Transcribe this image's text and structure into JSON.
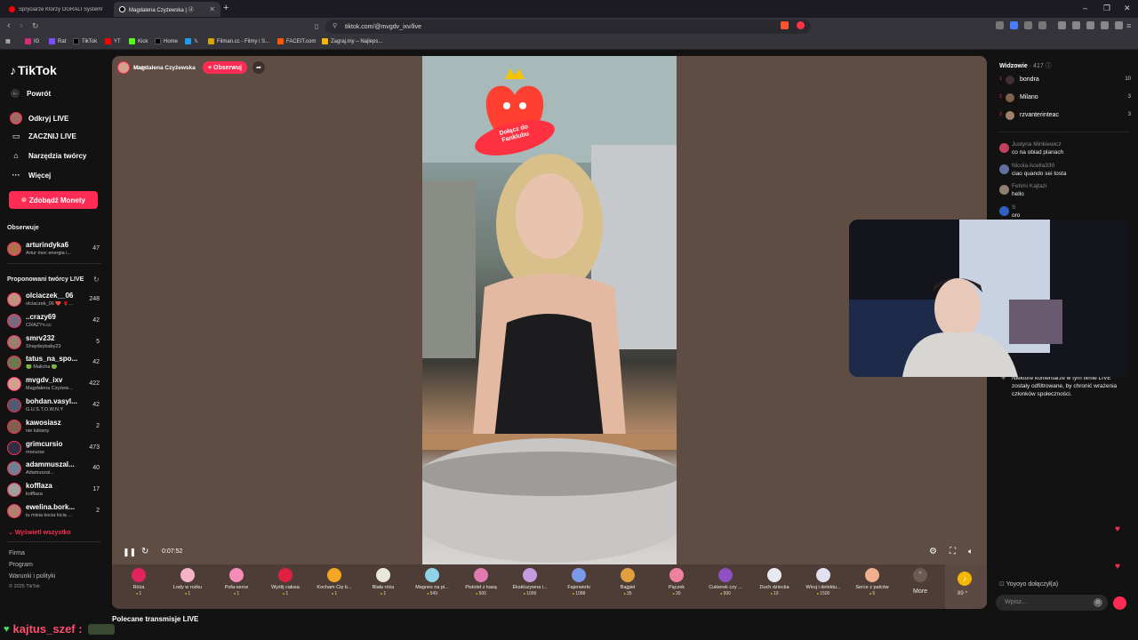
{
  "browser": {
    "tabs": [
      {
        "title": "Spryciarze Którzy OGRALI System! TT",
        "favicon_color": "#ff0000"
      },
      {
        "title": "Magdalena Czyżewska | ⓓ",
        "favicon_color": "#000000"
      }
    ],
    "new_tab": "+",
    "window_controls": [
      "–",
      "❐",
      "✕"
    ],
    "url": "tiktok.com/@mvgdv_ixv/live",
    "bookmarks": [
      {
        "label": "IG",
        "color": "#d62976"
      },
      {
        "label": "Rat",
        "color": "#7b4dff"
      },
      {
        "label": "TikTok",
        "color": "#000000"
      },
      {
        "label": "YT",
        "color": "#ff0000"
      },
      {
        "label": "Kick",
        "color": "#53fc18"
      },
      {
        "label": "Home",
        "color": "#000000"
      },
      {
        "label": "𝕏",
        "color": "#1d9bf0"
      },
      {
        "label": "Filman.cc - Filmy i S...",
        "color": "#d9a400"
      },
      {
        "label": "FACEIT.com",
        "color": "#ff5500"
      },
      {
        "label": "Zagraj.my – Najleps...",
        "color": "#f2b600"
      }
    ]
  },
  "sidebar": {
    "logo": "TikTok",
    "nav": [
      {
        "icon": "←",
        "label": "Powrót"
      },
      {
        "icon": "●",
        "label": "Odkryj LIVE"
      },
      {
        "icon": "▭",
        "label": "ZACZNIJ LIVE"
      },
      {
        "icon": "⌂",
        "label": "Narzędzia twórcy"
      },
      {
        "icon": "···",
        "label": "Więcej"
      }
    ],
    "coins_button": "Zdobądź Monety",
    "following_header": "Obserwuje",
    "following": [
      {
        "name": "arturindyka6",
        "sub": "Artur moc energia i...",
        "count": "47",
        "color": "#b07050"
      }
    ],
    "suggested_header": "Proponowani twórcy LIVE",
    "suggested": [
      {
        "name": "olciaczek__06",
        "sub": "olciaczek_06 ❤️ 🌹...",
        "count": "248",
        "color": "#c09080"
      },
      {
        "name": "..crazy69",
        "sub": "CRAZYn.cc",
        "count": "42",
        "color": "#7a6a80"
      },
      {
        "name": "smrv232",
        "sub": "Shaydeybaby23",
        "count": "5",
        "color": "#9a8070"
      },
      {
        "name": "tatus_na_spo...",
        "sub": "🟢 Malicha 🟢",
        "count": "42",
        "color": "#6a7a50"
      },
      {
        "name": "mvgdv_ixv",
        "sub": "Magdalena Czyżew...",
        "count": "422",
        "color": "#d6a090"
      },
      {
        "name": "bohdan.vasyl...",
        "sub": "G.U.S.T.O.W.N.Y",
        "count": "42",
        "color": "#505a70"
      },
      {
        "name": "kawosiasz",
        "sub": "nie lubiany",
        "count": "2",
        "color": "#806050"
      },
      {
        "name": "grimcursio",
        "sub": "mocurse",
        "count": "473",
        "color": "#303040"
      },
      {
        "name": "adammuszal...",
        "sub": "Adamuszal...",
        "count": "40",
        "color": "#708090"
      },
      {
        "name": "kofflaza",
        "sub": "kofflaza",
        "count": "17",
        "color": "#a0a0a0"
      },
      {
        "name": "ewelina.bork...",
        "sub": "tu misia kocia kicia ...",
        "count": "2",
        "color": "#b08070"
      }
    ],
    "show_all": "Wyświetl wszystko",
    "footer": [
      "Firma",
      "Program",
      "Warunki i polityki"
    ],
    "copyright": "© 2025 TikTok"
  },
  "stream": {
    "host_name": "Magdalena Czyżewska",
    "host_likes": "♥ 2.9K",
    "follow": "+ Obserwuj",
    "fanclub_badge": "Dołącz do Fanklubu",
    "time": "0:07:52",
    "gifts": [
      {
        "name": "Róża",
        "price": "1",
        "color": "#e0245e"
      },
      {
        "name": "Lody w rożku",
        "price": "1",
        "color": "#f6b3c8"
      },
      {
        "name": "Pofa-serce",
        "price": "1",
        "color": "#f58bb7"
      },
      {
        "name": "Wyślij całusa",
        "price": "1",
        "color": "#e02040"
      },
      {
        "name": "Kocham Cię b...",
        "price": "1",
        "color": "#f5a623"
      },
      {
        "name": "Biała róża",
        "price": "1",
        "color": "#e8e8d8"
      },
      {
        "name": "Magnes na pi...",
        "price": "549",
        "color": "#8fd3e8"
      },
      {
        "name": "Pistolet z kasą",
        "price": "500",
        "color": "#e07ab0"
      },
      {
        "name": "Ekskluzywna i...",
        "price": "1099",
        "color": "#c59ae0"
      },
      {
        "name": "Fajerwerki",
        "price": "1088",
        "color": "#7a9ae8"
      },
      {
        "name": "Bajgiel",
        "price": "35",
        "color": "#e0a040"
      },
      {
        "name": "Pączek",
        "price": "30",
        "color": "#f080a0"
      },
      {
        "name": "Cukierek czy ...",
        "price": "500",
        "color": "#9050c0"
      },
      {
        "name": "Duch dziecka",
        "price": "10",
        "color": "#e8e8f0"
      },
      {
        "name": "Wiruj i delektu...",
        "price": "1500",
        "color": "#e0e0f0"
      },
      {
        "name": "Serce z palców",
        "price": "5",
        "color": "#f0b090"
      }
    ],
    "more_label": "More",
    "coin_balance": "89 ^"
  },
  "right_panel": {
    "viewers_label": "Widzowie",
    "viewers_count": "· 417",
    "top_viewers": [
      {
        "rank": "1",
        "name": "bondra",
        "score": "10",
        "color": "#403030"
      },
      {
        "rank": "2",
        "name": "Milano",
        "score": "3",
        "color": "#806050"
      },
      {
        "rank": "3",
        "name": "rzvanterinteac",
        "score": "3",
        "color": "#a08070"
      }
    ],
    "comments": [
      {
        "user": "Justyna Minkiewicz",
        "text": "co na obiad planach",
        "color": "#c04060"
      },
      {
        "user": "Nicola Acella330",
        "text": "ciao quando sei tosta",
        "color": "#6070a0"
      },
      {
        "user": "Fehmi Kajtazi",
        "text": "hello",
        "color": "#908070"
      },
      {
        "user": "S",
        "text": "oro",
        "color": "#3060c0"
      }
    ],
    "system_message": "Niektóre komentarze w tym filmie LIVE zostały odfiltrowane, by chronić wrażenia członków społeczności.",
    "join_message": "Yoyoyo dołączył(a)",
    "input_placeholder": "Wpisz..."
  },
  "recommended_title": "Polecane transmisje LIVE",
  "overlay_user": "kajtus_szef :",
  "colors": {
    "accent": "#fe2c55",
    "video_bg": "#5f4c43"
  }
}
